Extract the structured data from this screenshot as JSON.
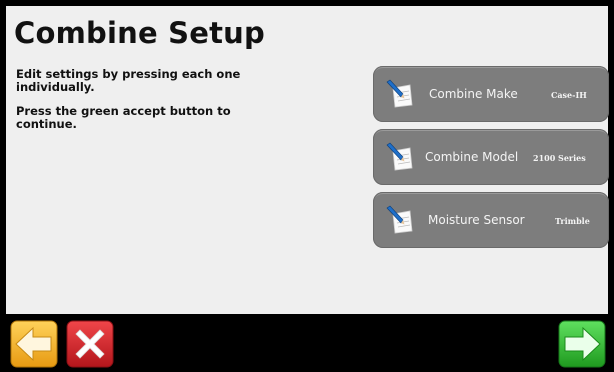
{
  "page": {
    "title": "Combine Setup"
  },
  "instructions": {
    "line1": "Edit settings by pressing each one individually.",
    "line2": "Press the green accept button to continue."
  },
  "settings": [
    {
      "label": "Combine Make",
      "value": "Case-IH",
      "icon": "edit-note-icon"
    },
    {
      "label": "Combine Model",
      "value": "2100 Series",
      "icon": "edit-note-icon"
    },
    {
      "label": "Moisture Sensor",
      "value": "Trimble",
      "icon": "edit-note-icon"
    }
  ],
  "nav": {
    "back_icon": "back-arrow-icon",
    "cancel_icon": "cancel-x-icon",
    "accept_icon": "accept-arrow-icon"
  },
  "colors": {
    "background": "#efefef",
    "button": "#7d7d7d",
    "back": "#f2b62c",
    "cancel": "#d8232a",
    "accept": "#2fb62f"
  }
}
